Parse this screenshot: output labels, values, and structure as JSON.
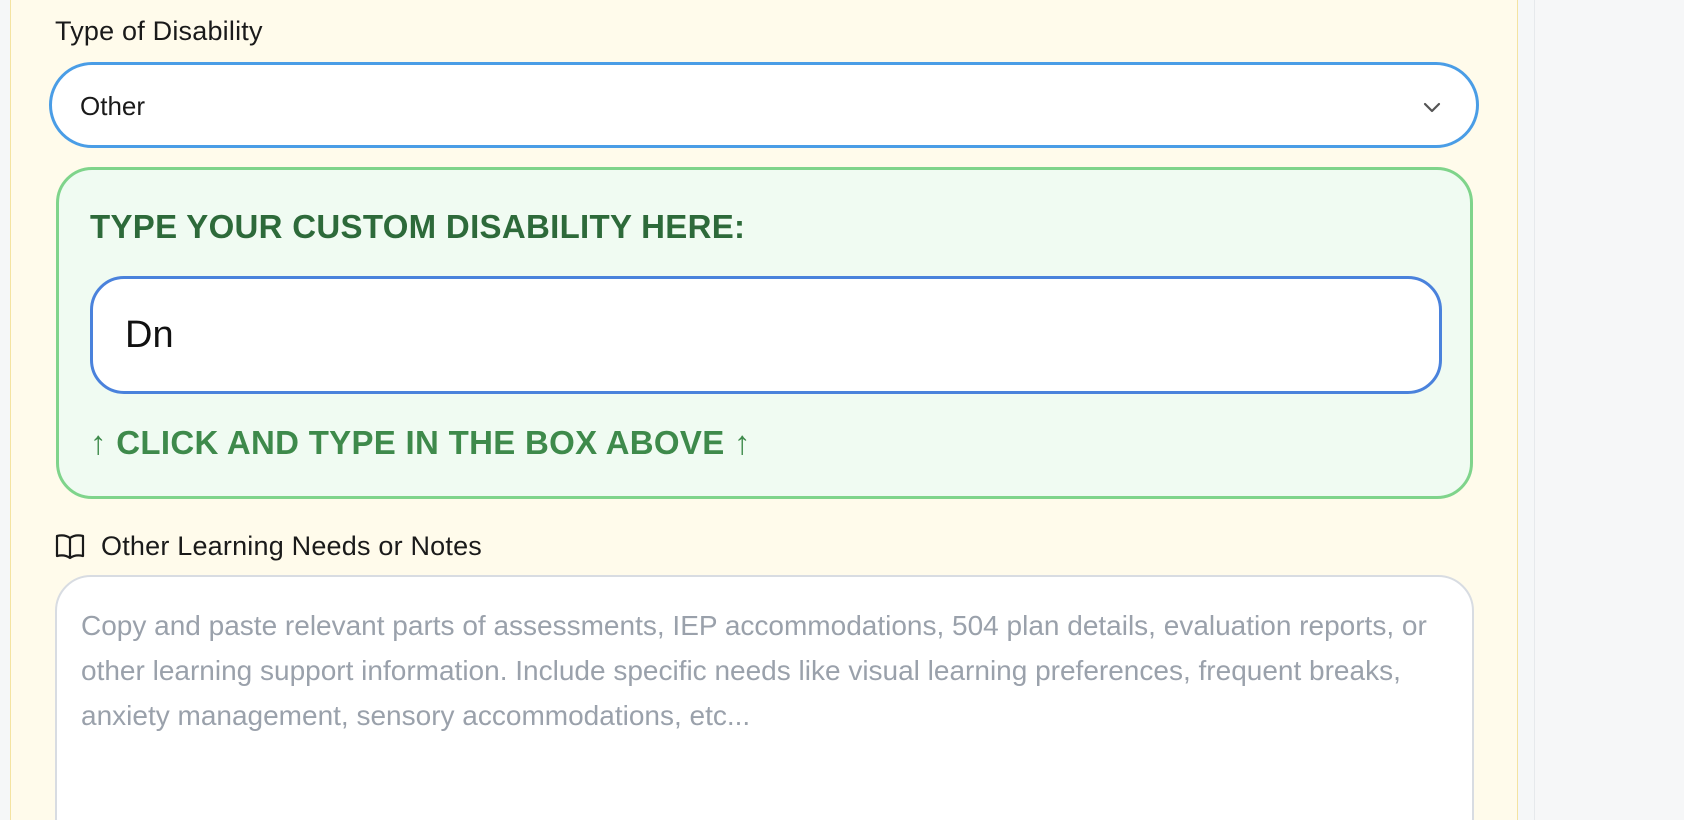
{
  "disability": {
    "label": "Type of Disability",
    "selected": "Other"
  },
  "custom": {
    "heading": "TYPE YOUR CUSTOM DISABILITY HERE:",
    "value": "Dn",
    "hint": "↑ CLICK AND TYPE IN THE BOX ABOVE ↑"
  },
  "notes": {
    "label": "Other Learning Needs or Notes",
    "icon": "book-open-icon",
    "placeholder": "Copy and paste relevant parts of assessments, IEP accommodations, 504 plan details, evaluation reports, or other learning support information. Include specific needs like visual learning preferences, frequent breaks, anxiety management, sensory accommodations, etc..."
  },
  "colors": {
    "panel_bg": "#fffbeb",
    "select_border": "#4a9de6",
    "custom_bg": "#f0fbf2",
    "custom_border": "#7fd48b",
    "heading_green": "#2d6a3a",
    "hint_green": "#3e8a4b",
    "input_border": "#4a82dc"
  }
}
